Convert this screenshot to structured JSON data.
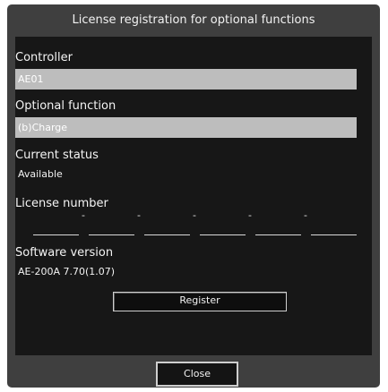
{
  "dialog": {
    "title": "License registration for optional functions"
  },
  "controller": {
    "label": "Controller",
    "value": "AE01"
  },
  "optional_function": {
    "label": "Optional function",
    "value": "(b)Charge"
  },
  "current_status": {
    "label": "Current status",
    "value": "Available"
  },
  "license_number": {
    "label": "License number",
    "segments": [
      "",
      "",
      "",
      "",
      "",
      ""
    ],
    "separator": "-"
  },
  "software_version": {
    "label": "Software version",
    "value": "AE-200A 7.70(1.07)"
  },
  "buttons": {
    "register": "Register",
    "close": "Close"
  },
  "colors": {
    "dialog_bg": "#3f3f3f",
    "panel_bg": "#171717",
    "field_bg": "#bdbdbd",
    "text": "#f4f4f4"
  }
}
